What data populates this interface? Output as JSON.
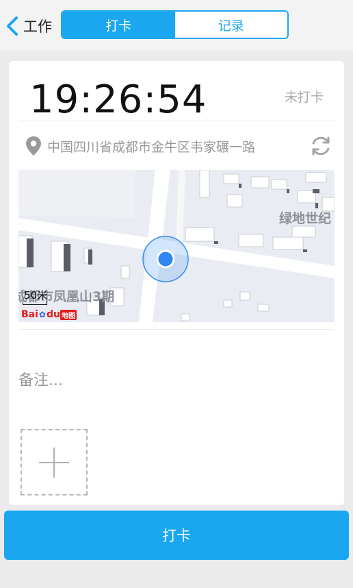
{
  "header": {
    "back_label": "工作",
    "tabs": [
      {
        "label": "打卡",
        "active": true
      },
      {
        "label": "记录",
        "active": false
      }
    ]
  },
  "clock": {
    "time": "19:26:54",
    "status": "未打卡"
  },
  "location": {
    "address": "中国四川省成都市金牛区韦家碾一路"
  },
  "map": {
    "labels": [
      "绿地世纪",
      "成都市凤凰山3期"
    ],
    "scale_label": "50米",
    "logo_text_1": "Bai",
    "logo_text_2": "du",
    "logo_text_3": "地图"
  },
  "remark": {
    "placeholder": "备注..."
  },
  "actions": {
    "punch_label": "打卡"
  },
  "colors": {
    "accent": "#1ba7f0",
    "location_dot": "#2f86f5"
  }
}
